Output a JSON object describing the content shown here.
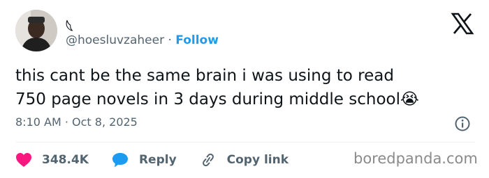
{
  "author": {
    "display_name": "𓆩",
    "handle": "@hoesluvzaheer",
    "separator": " · ",
    "follow_label": "Follow"
  },
  "tweet": {
    "line1": "this cant be the same brain i was using to read",
    "line2": "750 page novels in 3 days during middle school",
    "emoji": "😭"
  },
  "meta": {
    "time": "8:10 AM",
    "separator": " · ",
    "date": "Oct 8, 2025"
  },
  "actions": {
    "likes": "348.4K",
    "reply": "Reply",
    "copy_link": "Copy link"
  },
  "watermark": "boredpanda.com",
  "colors": {
    "accent": "#1d9bf0",
    "like": "#f91880",
    "muted": "#536471"
  }
}
